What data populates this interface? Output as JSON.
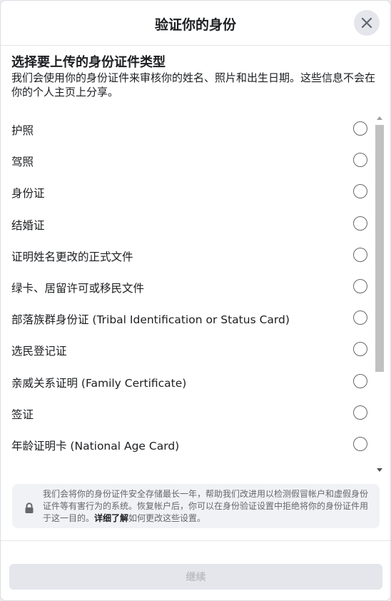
{
  "header": {
    "title": "验证你的身份",
    "close_icon": "close-icon"
  },
  "content": {
    "heading": "选择要上传的身份证件类型",
    "description": "我们会使用你的身份证件来审核你的姓名、照片和出生日期。这些信息不会在你的个人主页上分享。"
  },
  "options": [
    "护照",
    "驾照",
    "身份证",
    "结婚证",
    "证明姓名更改的正式文件",
    "绿卡、居留许可或移民文件",
    "部落族群身份证 (Tribal Identification or Status Card)",
    "选民登记证",
    "亲威关系证明 (Family Certificate)",
    "签证",
    "年龄证明卡 (National Age Card)"
  ],
  "notice": {
    "icon": "lock-icon",
    "text_before": "我们会将你的身份证件安全存储最长一年，帮助我们改进用以检测假冒帐户和虚假身份证件等有害行为的系统。恢复帐户后，你可以在身份验证设置中拒绝将你的身份证件用于这一目的。",
    "link": "详细了解",
    "text_after": "如何更改这些设置。"
  },
  "footer": {
    "continue_label": "继续"
  }
}
